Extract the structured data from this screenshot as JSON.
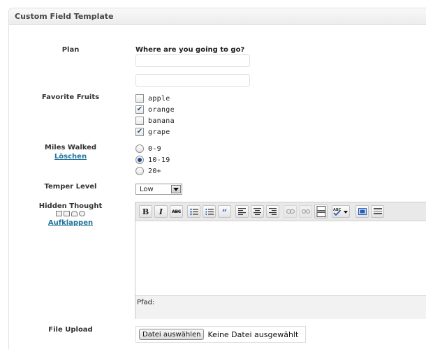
{
  "panel": {
    "title": "Custom Field Template"
  },
  "fields": {
    "plan": {
      "label": "Plan",
      "question": "Where are you going to go?",
      "inputs": [
        "",
        ""
      ]
    },
    "fruits": {
      "label": "Favorite Fruits",
      "options": [
        {
          "label": "apple",
          "checked": false
        },
        {
          "label": "orange",
          "checked": true
        },
        {
          "label": "banana",
          "checked": false
        },
        {
          "label": "grape",
          "checked": true
        }
      ]
    },
    "miles": {
      "label": "Miles Walked",
      "clear_link": "Löschen",
      "options": [
        {
          "label": "0-9",
          "selected": false
        },
        {
          "label": "10-19",
          "selected": true
        },
        {
          "label": "20+",
          "selected": false
        }
      ]
    },
    "temper": {
      "label": "Temper Level",
      "selected": "Low"
    },
    "hidden_thought": {
      "label": "Hidden Thought",
      "expand_link": "Aufklappen",
      "path_label": "Pfad:",
      "toolbar_icons": [
        "bold-icon",
        "italic-icon",
        "strikethrough-icon",
        "bullet-list-icon",
        "numbered-list-icon",
        "blockquote-icon",
        "align-left-icon",
        "align-center-icon",
        "align-right-icon",
        "link-icon",
        "unlink-icon",
        "more-tag-icon",
        "spellcheck-icon",
        "fullscreen-icon",
        "kitchen-sink-icon"
      ]
    },
    "file_upload": {
      "label": "File Upload",
      "button": "Datei auswählen",
      "status": "Keine Datei ausgewählt"
    }
  },
  "colors": {
    "link": "#21759b",
    "check": "#2b4d88"
  }
}
